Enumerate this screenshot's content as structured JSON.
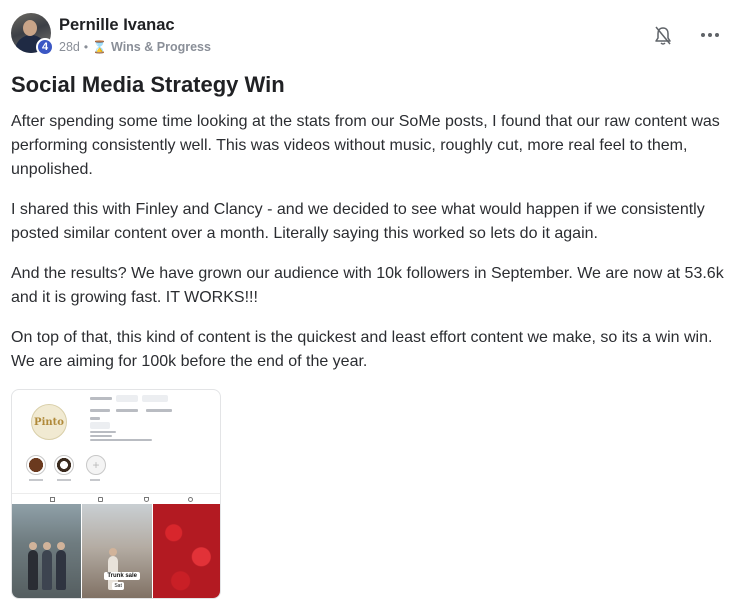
{
  "post": {
    "author": "Pernille Ivanac",
    "level": "4",
    "age": "28d",
    "separator": "•",
    "category_icon": "hourglass-icon",
    "category": "Wins & Progress",
    "title": "Social Media Strategy Win",
    "paragraphs": [
      "After spending some time looking at the stats from our SoMe posts, I found that our raw content was performing consistently well. This was videos without music, roughly cut, more real feel to them, unpolished.",
      "I shared this with Finley and Clancy - and we decided to see what would happen if we consistently posted similar content over a month. Literally saying this worked so lets do it again.",
      "And the results? We have grown our audience with 10k followers in September. We are now at 53.6k and it is growing fast. IT WORKS!!!",
      "On top of that, this kind of content is the quickest and least effort content we make, so its a win win. We are aiming for 100k before the end of the year."
    ]
  },
  "actions": {
    "bell_icon": "bell-off-icon",
    "more_icon": "more-horizontal-icon"
  },
  "attachment": {
    "logo_text": "Pinto",
    "caption": "Trunk sale",
    "caption2": "Sat"
  },
  "colors": {
    "level_badge": "#3b57c4",
    "category_icon": "#d9a21b",
    "meta_text": "#8a8f98"
  }
}
